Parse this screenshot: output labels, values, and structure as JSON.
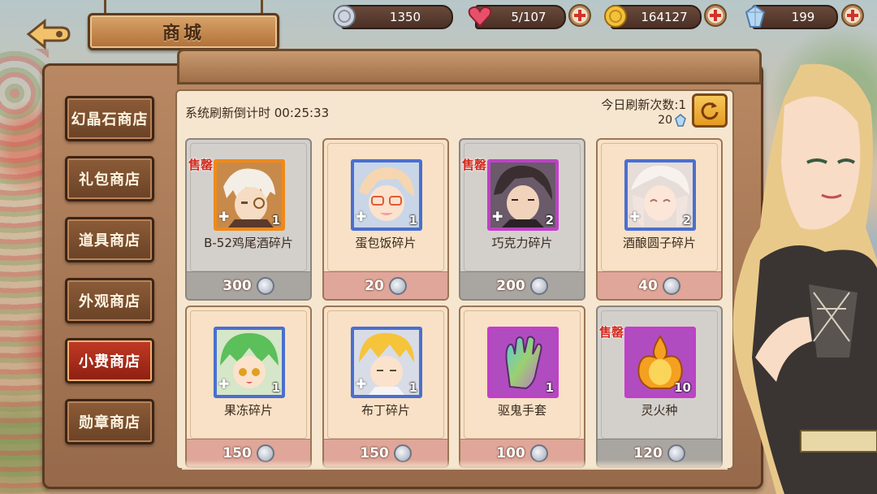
{
  "header": {
    "title": "商城",
    "resources": [
      {
        "id": "silver",
        "value": "1350",
        "icon": "silver-coin-icon"
      },
      {
        "id": "stamina",
        "value": "5/107",
        "icon": "heart-icon"
      },
      {
        "id": "gold",
        "value": "164127",
        "icon": "gold-coin-icon"
      },
      {
        "id": "crystal",
        "value": "199",
        "icon": "crystal-icon"
      }
    ]
  },
  "sidebar": {
    "items": [
      {
        "label": "幻晶石商店",
        "active": false
      },
      {
        "label": "礼包商店",
        "active": false
      },
      {
        "label": "道具商店",
        "active": false
      },
      {
        "label": "外观商店",
        "active": false
      },
      {
        "label": "小费商店",
        "active": true
      },
      {
        "label": "勋章商店",
        "active": false
      }
    ]
  },
  "shop": {
    "refresh_timer": "系统刷新倒计时 00:25:33",
    "refresh_count": "今日刷新次数:1",
    "refresh_cost": "20",
    "sold_label": "售罄",
    "items": [
      {
        "name": "B-52鸡尾酒碎片",
        "qty": "1",
        "price": "300",
        "sold": true,
        "frame": "orange",
        "fragment": true
      },
      {
        "name": "蛋包饭碎片",
        "qty": "1",
        "price": "20",
        "sold": false,
        "frame": "blue",
        "fragment": true
      },
      {
        "name": "巧克力碎片",
        "qty": "2",
        "price": "200",
        "sold": true,
        "frame": "purple",
        "fragment": true
      },
      {
        "name": "酒酿圆子碎片",
        "qty": "2",
        "price": "40",
        "sold": false,
        "frame": "blue",
        "fragment": true
      },
      {
        "name": "果冻碎片",
        "qty": "1",
        "price": "150",
        "sold": false,
        "frame": "blue",
        "fragment": true
      },
      {
        "name": "布丁碎片",
        "qty": "1",
        "price": "150",
        "sold": false,
        "frame": "blue",
        "fragment": true
      },
      {
        "name": "驱鬼手套",
        "qty": "1",
        "price": "100",
        "sold": false,
        "frame": "purple",
        "fragment": false
      },
      {
        "name": "灵火种",
        "qty": "10",
        "price": "120",
        "sold": true,
        "frame": "purple",
        "fragment": false
      }
    ]
  },
  "colors": {
    "active_tab": "#c23a24",
    "sold_tag": "#d22a1c",
    "price_bar": "#dfa699",
    "sold_bar": "#a9a5a1"
  }
}
